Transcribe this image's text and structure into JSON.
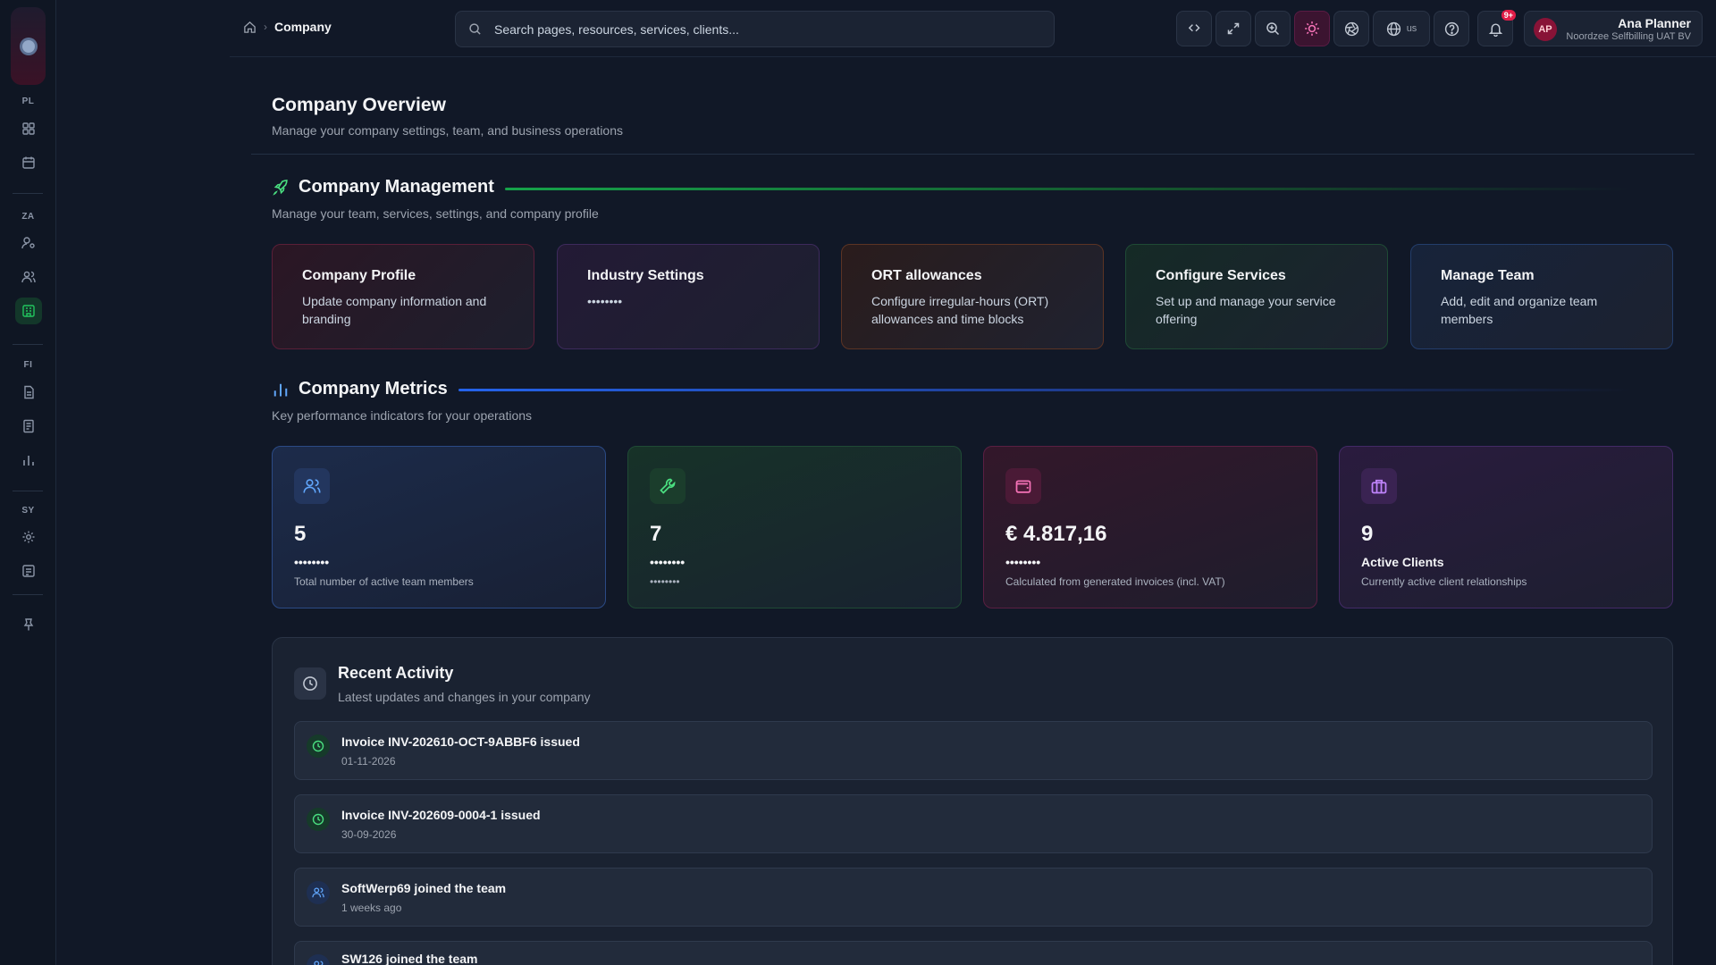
{
  "sidebar": {
    "sections": [
      "PL",
      "ZA",
      "FI",
      "SY"
    ]
  },
  "topbar": {
    "breadcrumb_current": "Company",
    "search_placeholder": "Search pages, resources, services, clients...",
    "language": "us",
    "notifications_badge": "9+",
    "user": {
      "initials": "AP",
      "name": "Ana Planner",
      "org": "Noordzee Selfbilling UAT BV"
    }
  },
  "page": {
    "title": "Company Overview",
    "subtitle": "Manage your company settings, team, and business operations"
  },
  "management": {
    "title": "Company Management",
    "subtitle": "Manage your team, services, settings, and company profile",
    "cards": [
      {
        "title": "Company Profile",
        "desc": "Update company information and branding"
      },
      {
        "title": "Industry Settings",
        "desc": "••••••••"
      },
      {
        "title": "ORT allowances",
        "desc": "Configure irregular-hours (ORT) allowances and time blocks"
      },
      {
        "title": "Configure Services",
        "desc": "Set up and manage your service offering"
      },
      {
        "title": "Manage Team",
        "desc": "Add, edit and organize team members"
      }
    ]
  },
  "metrics": {
    "title": "Company Metrics",
    "subtitle": "Key performance indicators for your operations",
    "cards": [
      {
        "value": "5",
        "label": "••••••••",
        "desc": "Total number of active team members",
        "icon": "users-icon",
        "color": "#60a5fa"
      },
      {
        "value": "7",
        "label": "••••••••",
        "desc": "••••••••",
        "icon": "wrench-icon",
        "color": "#4ade80"
      },
      {
        "value": "€ 4.817,16",
        "label": "••••••••",
        "desc": "Calculated from generated invoices (incl. VAT)",
        "icon": "wallet-icon",
        "color": "#f472b6"
      },
      {
        "value": "9",
        "label": "Active Clients",
        "desc": "Currently active client relationships",
        "icon": "briefcase-icon",
        "color": "#c084fc"
      }
    ]
  },
  "activity": {
    "title": "Recent Activity",
    "subtitle": "Latest updates and changes in your company",
    "items": [
      {
        "title": "Invoice INV-202610-OCT-9ABBF6 issued",
        "time": "01-11-2026",
        "icon": "clock-icon"
      },
      {
        "title": "Invoice INV-202609-0004-1 issued",
        "time": "30-09-2026",
        "icon": "clock-icon"
      },
      {
        "title": "SoftWerp69 joined the team",
        "time": "1 weeks ago",
        "icon": "users-icon"
      },
      {
        "title": "SW126 joined the team",
        "time": "",
        "icon": "users-icon"
      }
    ]
  }
}
